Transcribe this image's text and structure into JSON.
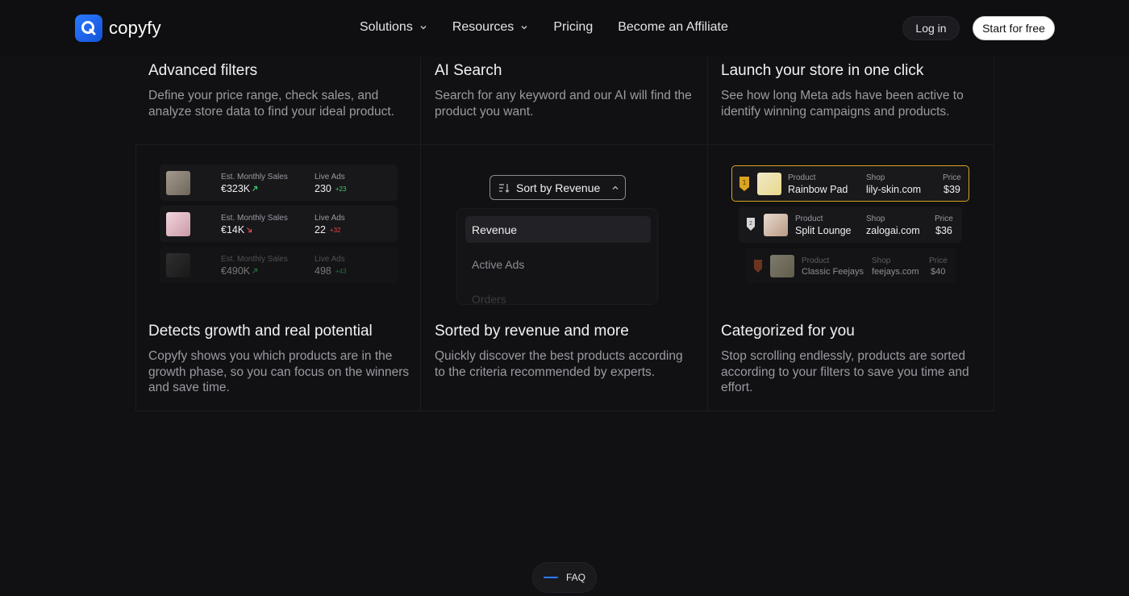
{
  "nav": {
    "brand": "copyfy",
    "menu": [
      {
        "label": "Solutions",
        "has_dropdown": true
      },
      {
        "label": "Resources",
        "has_dropdown": true
      },
      {
        "label": "Pricing",
        "has_dropdown": false
      },
      {
        "label": "Become an Affiliate",
        "has_dropdown": false
      }
    ],
    "login": "Log in",
    "cta": "Start for free"
  },
  "features_top": [
    {
      "title": "Advanced filters",
      "desc_lines": [
        "Define your price range, check sales, and",
        "analyze store data to find your ideal product."
      ]
    },
    {
      "title": "AI Search",
      "desc_lines": [
        "Search for any keyword and our AI will find the",
        "product you want."
      ]
    },
    {
      "title": "Launch your store in one click",
      "desc_lines": [
        "See how long Meta ads have been active to",
        "identify winning campaigns and products."
      ]
    }
  ],
  "growth_rows": [
    {
      "sales_label": "Est. Monthly Sales",
      "sales": "€323K",
      "trend": "up",
      "ads_label": "Live Ads",
      "ads": "230",
      "delta": "+23"
    },
    {
      "sales_label": "Est. Monthly Sales",
      "sales": "€14K",
      "trend": "down",
      "ads_label": "Live Ads",
      "ads": "22",
      "delta": "+32"
    },
    {
      "sales_label": "Est. Monthly Sales",
      "sales": "€490K",
      "trend": "up",
      "ads_label": "Live Ads",
      "ads": "498",
      "delta": "+43"
    }
  ],
  "sort": {
    "button": "Sort by Revenue",
    "options": [
      "Revenue",
      "Active Ads",
      "Orders"
    ]
  },
  "categorized": [
    {
      "rank": "1",
      "product_label": "Product",
      "product": "Rainbow Pad",
      "shop_label": "Shop",
      "shop": "lily-skin.com",
      "price_label": "Price",
      "price": "$39"
    },
    {
      "rank": "2",
      "product_label": "Product",
      "product": "Split Lounge",
      "shop_label": "Shop",
      "shop": "zalogai.com",
      "price_label": "Price",
      "price": "$36"
    },
    {
      "rank": "3",
      "product_label": "Product",
      "product": "Classic Feejays",
      "shop_label": "Shop",
      "shop": "feejays.com",
      "price_label": "Price",
      "price": "$40"
    }
  ],
  "features_bottom": [
    {
      "title": "Detects growth and real potential",
      "desc_lines": [
        "Copyfy shows you which products are in the",
        "growth phase, so you can focus on the winners",
        "and save time."
      ]
    },
    {
      "title": "Sorted by revenue and more",
      "desc_lines": [
        "Quickly discover the best products according",
        "to the criteria recommended by experts."
      ]
    },
    {
      "title": "Categorized for you",
      "desc_lines": [
        "Stop scrolling endlessly, products are sorted",
        "according to your filters to save you time and",
        "effort."
      ]
    }
  ],
  "faq": "FAQ",
  "colors": {
    "accent": "#2a7bff",
    "gold": "#d9a521",
    "up": "#3ecf6b",
    "down": "#e5484d"
  }
}
